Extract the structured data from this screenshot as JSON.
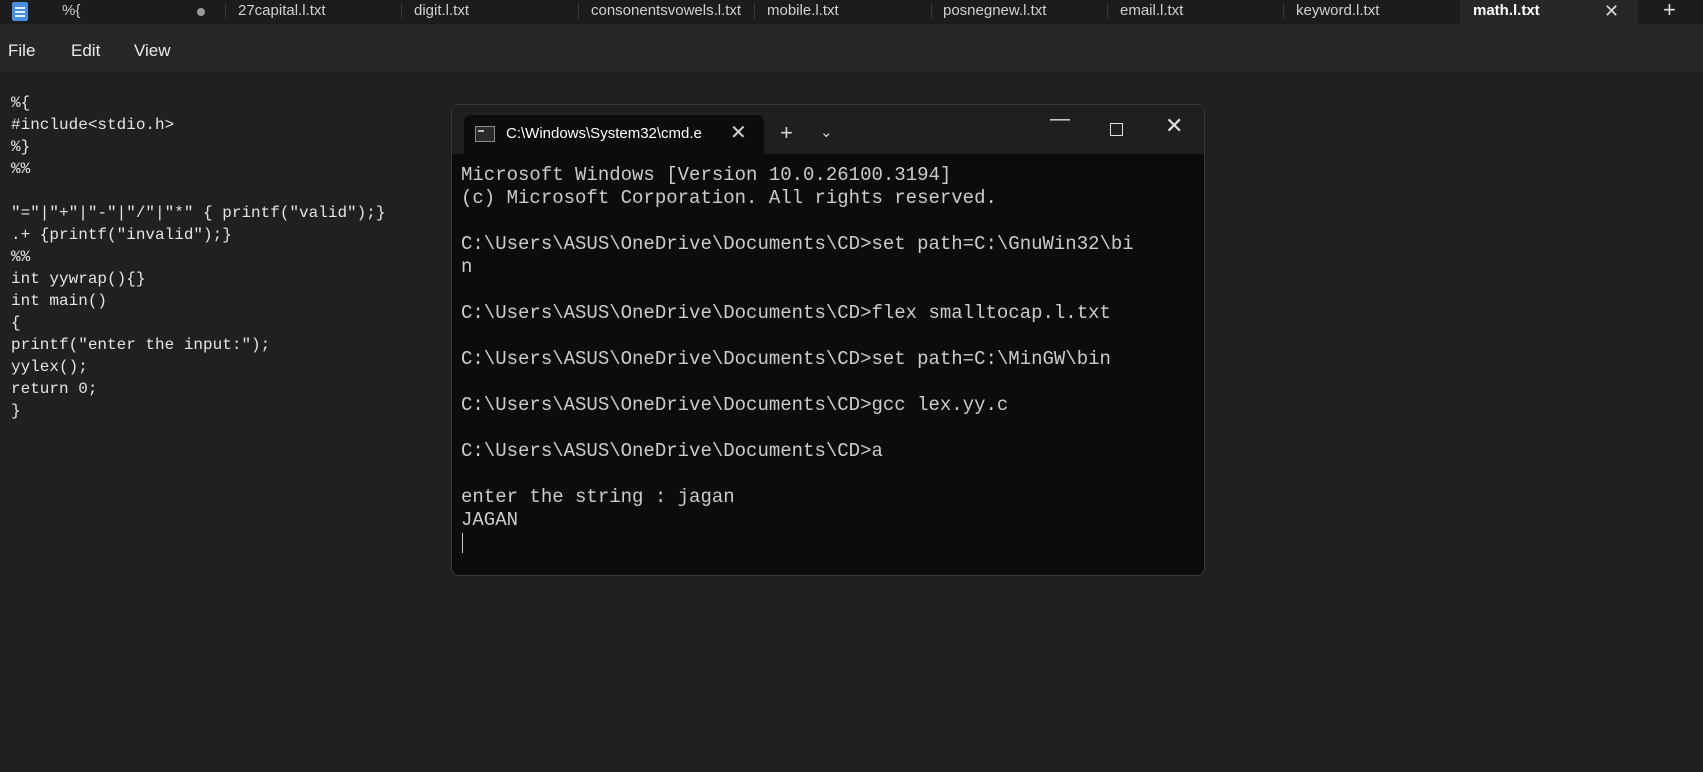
{
  "tabs": [
    {
      "label": "%{",
      "modified": true
    },
    {
      "label": "27capital.l.txt"
    },
    {
      "label": "digit.l.txt"
    },
    {
      "label": "consonentsvowels.l.txt"
    },
    {
      "label": "mobile.l.txt"
    },
    {
      "label": "posnegnew.l.txt"
    },
    {
      "label": "email.l.txt"
    },
    {
      "label": "keyword.l.txt"
    },
    {
      "label": "math.l.txt",
      "active": true
    }
  ],
  "menu": {
    "file": "File",
    "edit": "Edit",
    "view": "View"
  },
  "editor": {
    "lines": [
      "%{",
      "#include<stdio.h>",
      "%}",
      "%%",
      "",
      "\"=\"|\"+\"|\"-\"|\"/\"|\"*\" { printf(\"valid\");}",
      ".+ {printf(\"invalid\");}",
      "%%",
      "int yywrap(){}",
      "int main()",
      "{",
      "printf(\"enter the input:\");",
      "yylex();",
      "return 0;",
      "}"
    ]
  },
  "cmd": {
    "tab_title": "C:\\Windows\\System32\\cmd.e",
    "lines": [
      "Microsoft Windows [Version 10.0.26100.3194]",
      "(c) Microsoft Corporation. All rights reserved.",
      "",
      "C:\\Users\\ASUS\\OneDrive\\Documents\\CD>set path=C:\\GnuWin32\\bi",
      "n",
      "",
      "C:\\Users\\ASUS\\OneDrive\\Documents\\CD>flex smalltocap.l.txt",
      "",
      "C:\\Users\\ASUS\\OneDrive\\Documents\\CD>set path=C:\\MinGW\\bin",
      "",
      "C:\\Users\\ASUS\\OneDrive\\Documents\\CD>gcc lex.yy.c",
      "",
      "C:\\Users\\ASUS\\OneDrive\\Documents\\CD>a",
      "",
      "enter the string : jagan",
      "JAGAN"
    ]
  },
  "icons": {
    "tab_close": "✕",
    "new_tab": "+",
    "cmd_tab_close": "✕",
    "cmd_new_tab": "+",
    "cmd_dropdown": "⌄",
    "minimize": "—",
    "close": "✕"
  }
}
